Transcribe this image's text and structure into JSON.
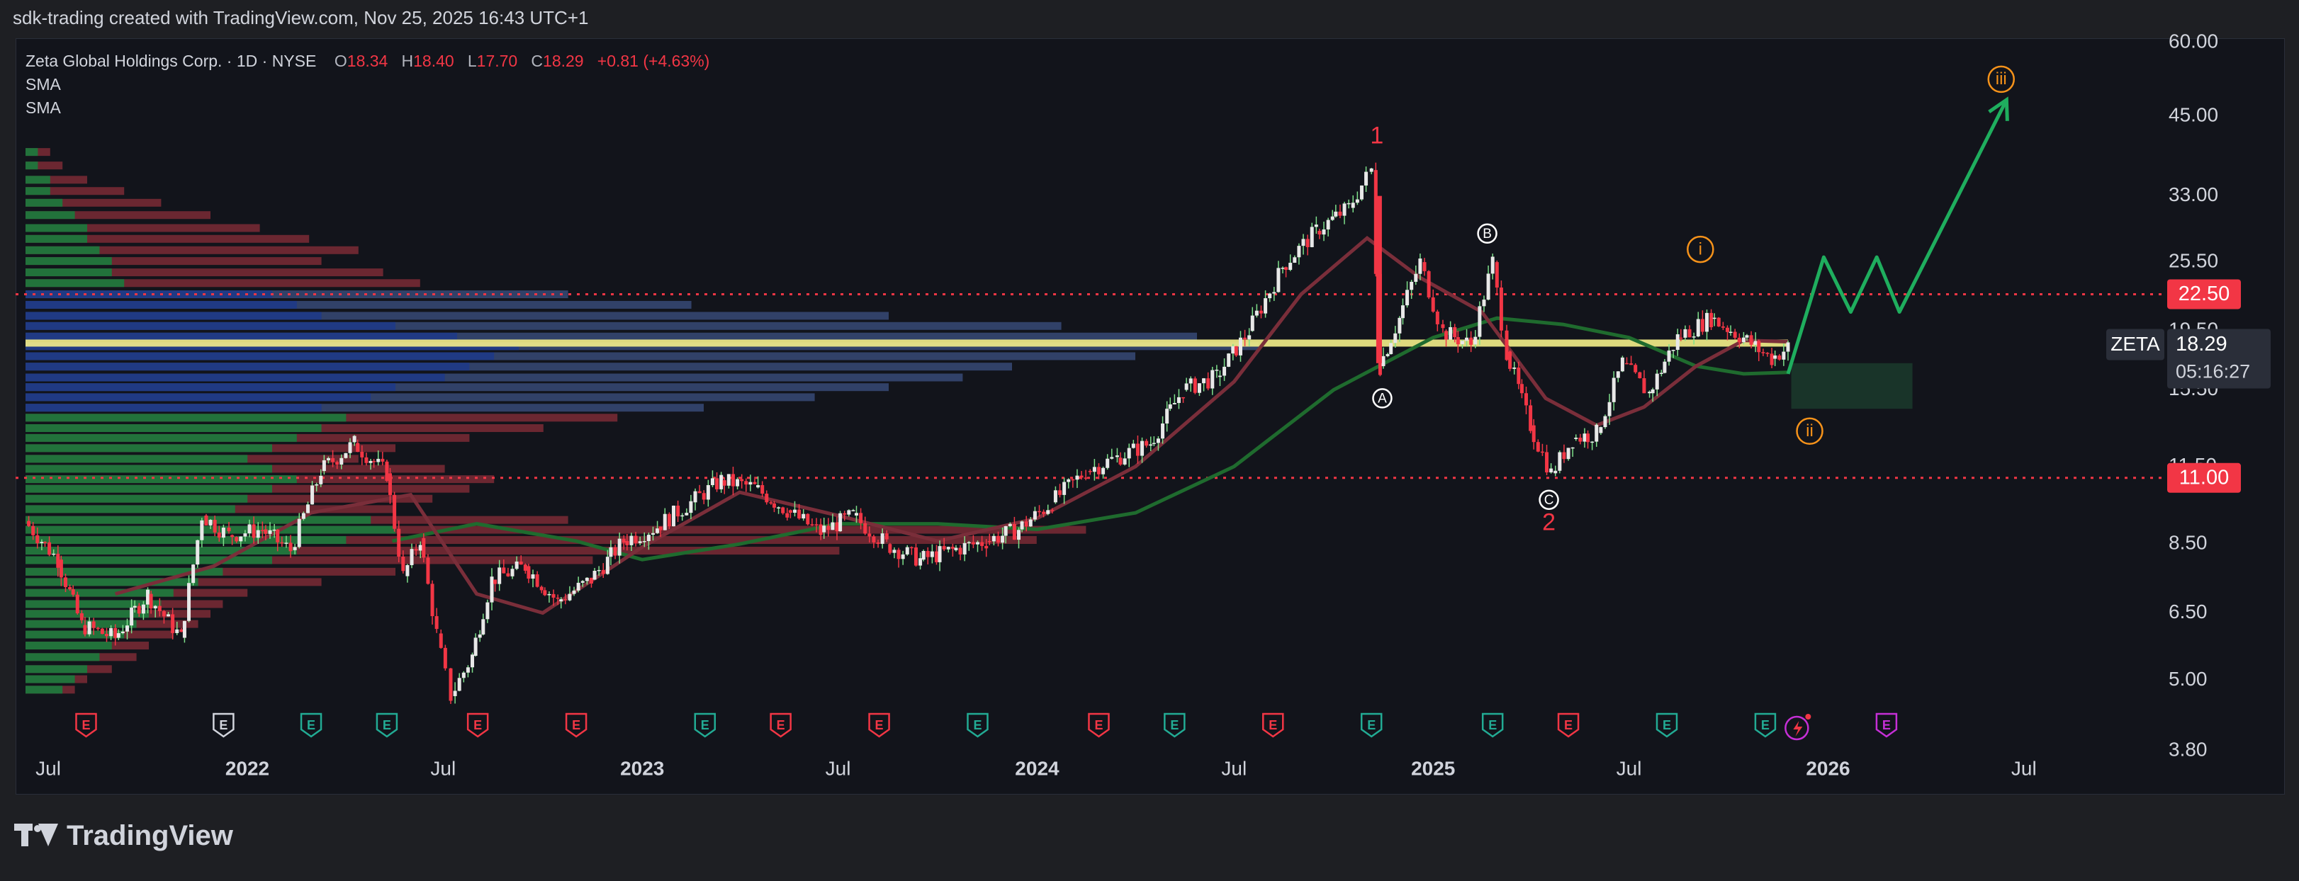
{
  "header": {
    "credit": "sdk-trading created with TradingView.com, Nov 25, 2025 16:43 UTC+1"
  },
  "legend": {
    "title": "Zeta Global Holdings Corp. · 1D · NYSE",
    "o_label": "O",
    "o": "18.34",
    "h_label": "H",
    "h": "18.40",
    "l_label": "L",
    "l": "17.70",
    "c_label": "C",
    "c": "18.29",
    "change": "+0.81 (+4.63%)",
    "indicators": [
      "SMA",
      "SMA"
    ]
  },
  "footer": {
    "brand": "TradingView"
  },
  "colors": {
    "up": "#22ab94",
    "down": "#f23645",
    "accent_orange": "#f7931a",
    "projection": "#1fae5e",
    "poc": "#f5ef8a",
    "sma_fast": "#7a2e3a",
    "sma_slow": "#1f6b2e"
  },
  "chart_data": {
    "type": "line",
    "symbol": "ZETA",
    "price_scale": "log",
    "ylim": [
      3.8,
      60
    ],
    "y_ticks": [
      "60.00",
      "45.00",
      "33.00",
      "25.50",
      "19.50",
      "15.50",
      "11.50",
      "8.50",
      "6.50",
      "5.00",
      "3.80"
    ],
    "x_ticks": [
      {
        "label": "Jul",
        "date": "2021-07-01"
      },
      {
        "label": "2022",
        "date": "2022-01-01",
        "bold": true
      },
      {
        "label": "Jul",
        "date": "2022-07-01"
      },
      {
        "label": "2023",
        "date": "2023-01-01",
        "bold": true
      },
      {
        "label": "Jul",
        "date": "2023-07-01"
      },
      {
        "label": "2024",
        "date": "2024-01-01",
        "bold": true
      },
      {
        "label": "Jul",
        "date": "2024-07-01"
      },
      {
        "label": "2025",
        "date": "2025-01-01",
        "bold": true
      },
      {
        "label": "Jul",
        "date": "2025-07-01"
      },
      {
        "label": "2026",
        "date": "2026-01-01",
        "bold": true
      },
      {
        "label": "Jul",
        "date": "2026-07-01"
      }
    ],
    "xlim": [
      "2021-06-10",
      "2026-10-10"
    ],
    "last_price": {
      "label": "ZETA",
      "value": "18.29",
      "countdown": "05:16:27"
    },
    "horizontal_levels": [
      {
        "price": 22.5,
        "label": "22.50"
      },
      {
        "price": 11.0,
        "label": "11.00"
      }
    ],
    "poc_price": 18.6,
    "price_path": [
      [
        "2021-06-10",
        9.3
      ],
      [
        "2021-07-10",
        8.0
      ],
      [
        "2021-08-01",
        6.2
      ],
      [
        "2021-09-01",
        5.9
      ],
      [
        "2021-10-01",
        7.0
      ],
      [
        "2021-11-01",
        5.9
      ],
      [
        "2021-11-20",
        9.5
      ],
      [
        "2021-12-15",
        8.8
      ],
      [
        "2022-01-15",
        9.0
      ],
      [
        "2022-02-10",
        8.3
      ],
      [
        "2022-03-10",
        11.3
      ],
      [
        "2022-04-10",
        12.6
      ],
      [
        "2022-05-10",
        11.2
      ],
      [
        "2022-05-25",
        7.5
      ],
      [
        "2022-06-10",
        8.7
      ],
      [
        "2022-06-25",
        6.0
      ],
      [
        "2022-07-08",
        4.7
      ],
      [
        "2022-07-28",
        5.5
      ],
      [
        "2022-08-15",
        7.4
      ],
      [
        "2022-09-15",
        7.8
      ],
      [
        "2022-10-15",
        6.8
      ],
      [
        "2022-11-15",
        7.4
      ],
      [
        "2022-12-15",
        8.6
      ],
      [
        "2023-01-15",
        9.1
      ],
      [
        "2023-02-15",
        10.0
      ],
      [
        "2023-03-15",
        10.9
      ],
      [
        "2023-04-15",
        10.6
      ],
      [
        "2023-05-15",
        9.7
      ],
      [
        "2023-06-15",
        8.9
      ],
      [
        "2023-07-15",
        9.5
      ],
      [
        "2023-08-15",
        8.5
      ],
      [
        "2023-09-15",
        8.0
      ],
      [
        "2023-10-15",
        8.3
      ],
      [
        "2023-11-15",
        8.6
      ],
      [
        "2023-12-15",
        9.0
      ],
      [
        "2024-01-15",
        10.0
      ],
      [
        "2024-02-15",
        11.3
      ],
      [
        "2024-03-15",
        11.9
      ],
      [
        "2024-04-15",
        12.6
      ],
      [
        "2024-05-15",
        15.5
      ],
      [
        "2024-06-15",
        16.3
      ],
      [
        "2024-07-15",
        19.5
      ],
      [
        "2024-08-15",
        25.0
      ],
      [
        "2024-09-15",
        28.8
      ],
      [
        "2024-10-15",
        31.5
      ],
      [
        "2024-11-05",
        36.5
      ],
      [
        "2024-11-13",
        17.0
      ],
      [
        "2024-12-01",
        20.5
      ],
      [
        "2024-12-20",
        25.5
      ],
      [
        "2025-01-10",
        19.5
      ],
      [
        "2025-02-05",
        18.5
      ],
      [
        "2025-02-25",
        25.5
      ],
      [
        "2025-03-10",
        18.0
      ],
      [
        "2025-04-01",
        13.5
      ],
      [
        "2025-04-20",
        11.2
      ],
      [
        "2025-05-10",
        12.8
      ],
      [
        "2025-06-01",
        13.1
      ],
      [
        "2025-06-25",
        17.2
      ],
      [
        "2025-07-20",
        15.3
      ],
      [
        "2025-08-15",
        19.0
      ],
      [
        "2025-09-15",
        20.5
      ],
      [
        "2025-10-15",
        19.0
      ],
      [
        "2025-11-10",
        17.5
      ],
      [
        "2025-11-25",
        18.29
      ]
    ],
    "sma_fast": [
      [
        "2021-09-01",
        7.0
      ],
      [
        "2021-12-01",
        7.8
      ],
      [
        "2022-03-01",
        9.6
      ],
      [
        "2022-06-01",
        10.3
      ],
      [
        "2022-08-01",
        7.0
      ],
      [
        "2022-10-01",
        6.5
      ],
      [
        "2023-01-01",
        8.4
      ],
      [
        "2023-04-01",
        10.4
      ],
      [
        "2023-07-01",
        9.5
      ],
      [
        "2023-10-01",
        8.6
      ],
      [
        "2024-01-01",
        9.4
      ],
      [
        "2024-04-01",
        11.5
      ],
      [
        "2024-07-01",
        16.0
      ],
      [
        "2024-09-01",
        22.5
      ],
      [
        "2024-11-01",
        28.0
      ],
      [
        "2024-12-20",
        24.0
      ],
      [
        "2025-02-15",
        21.0
      ],
      [
        "2025-04-15",
        15.0
      ],
      [
        "2025-06-01",
        13.5
      ],
      [
        "2025-07-15",
        14.5
      ],
      [
        "2025-09-01",
        17.0
      ],
      [
        "2025-10-15",
        18.8
      ],
      [
        "2025-11-25",
        18.7
      ]
    ],
    "sma_slow": [
      [
        "2022-05-15",
        8.6
      ],
      [
        "2022-08-01",
        9.2
      ],
      [
        "2022-11-01",
        8.6
      ],
      [
        "2023-01-01",
        8.0
      ],
      [
        "2023-04-01",
        8.5
      ],
      [
        "2023-07-01",
        9.2
      ],
      [
        "2023-10-01",
        9.2
      ],
      [
        "2024-01-01",
        9.0
      ],
      [
        "2024-04-01",
        9.6
      ],
      [
        "2024-07-01",
        11.5
      ],
      [
        "2024-10-01",
        15.5
      ],
      [
        "2025-01-01",
        19.0
      ],
      [
        "2025-03-01",
        20.5
      ],
      [
        "2025-05-01",
        20.0
      ],
      [
        "2025-07-01",
        19.0
      ],
      [
        "2025-09-01",
        17.0
      ],
      [
        "2025-10-15",
        16.5
      ],
      [
        "2025-11-25",
        16.6
      ]
    ],
    "projection": [
      [
        "2025-11-25",
        16.5
      ],
      [
        "2025-12-28",
        26.0
      ],
      [
        "2026-01-22",
        21.0
      ],
      [
        "2026-02-15",
        26.0
      ],
      [
        "2026-03-08",
        21.0
      ],
      [
        "2026-06-15",
        48.0
      ]
    ],
    "target_zone": {
      "x0": "2025-11-28",
      "x1": "2026-03-20",
      "y0": 17.2,
      "y1": 14.4
    },
    "wave_labels": [
      {
        "text": "1",
        "date": "2024-11-10",
        "price": 41.5,
        "style": "red"
      },
      {
        "text": "A",
        "date": "2024-11-15",
        "price": 15.0,
        "style": "circle-white"
      },
      {
        "text": "B",
        "date": "2025-02-20",
        "price": 28.5,
        "style": "circle-white"
      },
      {
        "text": "C",
        "date": "2025-04-18",
        "price": 10.1,
        "style": "circle-white"
      },
      {
        "text": "2",
        "date": "2025-04-18",
        "price": 9.2,
        "style": "red"
      },
      {
        "text": "i",
        "date": "2025-09-05",
        "price": 26.8,
        "style": "circle-orange"
      },
      {
        "text": "ii",
        "date": "2025-12-15",
        "price": 13.2,
        "style": "circle-orange"
      },
      {
        "text": "iii",
        "date": "2026-06-10",
        "price": 52.0,
        "style": "circle-orange"
      }
    ],
    "earnings": [
      {
        "date": "2021-08-05",
        "kind": "down",
        "label": "E"
      },
      {
        "date": "2021-12-10",
        "kind": "neutral",
        "label": "E"
      },
      {
        "date": "2022-03-01",
        "kind": "up",
        "label": "E"
      },
      {
        "date": "2022-05-10",
        "kind": "up",
        "label": "E"
      },
      {
        "date": "2022-08-02",
        "kind": "down",
        "label": "E"
      },
      {
        "date": "2022-11-01",
        "kind": "down",
        "label": "E"
      },
      {
        "date": "2023-02-28",
        "kind": "up",
        "label": "E"
      },
      {
        "date": "2023-05-09",
        "kind": "down",
        "label": "E"
      },
      {
        "date": "2023-08-08",
        "kind": "down",
        "label": "E"
      },
      {
        "date": "2023-11-07",
        "kind": "up",
        "label": "E"
      },
      {
        "date": "2024-02-27",
        "kind": "down",
        "label": "E"
      },
      {
        "date": "2024-05-07",
        "kind": "up",
        "label": "E"
      },
      {
        "date": "2024-08-06",
        "kind": "down",
        "label": "E"
      },
      {
        "date": "2024-11-05",
        "kind": "up",
        "label": "E"
      },
      {
        "date": "2025-02-25",
        "kind": "up",
        "label": "E"
      },
      {
        "date": "2025-05-06",
        "kind": "down",
        "label": "E"
      },
      {
        "date": "2025-08-05",
        "kind": "up",
        "label": "E"
      },
      {
        "date": "2025-11-04",
        "kind": "up",
        "label": "E"
      },
      {
        "date": "2026-02-24",
        "kind": "future",
        "label": "E"
      }
    ],
    "volume_profile": {
      "note": "bars grow rightward from left edge; value = relative length 0-1",
      "rows": [
        {
          "price": 39.0,
          "up": 0.01,
          "down": 0.02
        },
        {
          "price": 37.0,
          "up": 0.01,
          "down": 0.03
        },
        {
          "price": 35.0,
          "up": 0.02,
          "down": 0.05
        },
        {
          "price": 33.5,
          "up": 0.02,
          "down": 0.08
        },
        {
          "price": 32.0,
          "up": 0.03,
          "down": 0.11
        },
        {
          "price": 30.5,
          "up": 0.04,
          "down": 0.15
        },
        {
          "price": 29.0,
          "up": 0.05,
          "down": 0.19
        },
        {
          "price": 27.8,
          "up": 0.05,
          "down": 0.23
        },
        {
          "price": 26.6,
          "up": 0.06,
          "down": 0.27
        },
        {
          "price": 25.5,
          "up": 0.07,
          "down": 0.24
        },
        {
          "price": 24.4,
          "up": 0.07,
          "down": 0.29
        },
        {
          "price": 23.4,
          "up": 0.08,
          "down": 0.32
        },
        {
          "price": 22.4,
          "up": 0.2,
          "down": 0.44,
          "va": true
        },
        {
          "price": 21.5,
          "up": 0.22,
          "down": 0.54,
          "va": true
        },
        {
          "price": 20.6,
          "up": 0.24,
          "down": 0.7,
          "va": true
        },
        {
          "price": 19.8,
          "up": 0.3,
          "down": 0.84,
          "va": true
        },
        {
          "price": 19.0,
          "up": 0.35,
          "down": 0.95,
          "va": true
        },
        {
          "price": 18.3,
          "up": 0.4,
          "down": 1.0,
          "va": true
        },
        {
          "price": 17.6,
          "up": 0.38,
          "down": 0.9,
          "va": true
        },
        {
          "price": 16.9,
          "up": 0.36,
          "down": 0.8,
          "va": true
        },
        {
          "price": 16.2,
          "up": 0.34,
          "down": 0.76,
          "va": true
        },
        {
          "price": 15.6,
          "up": 0.3,
          "down": 0.7,
          "va": true
        },
        {
          "price": 15.0,
          "up": 0.28,
          "down": 0.64,
          "va": true
        },
        {
          "price": 14.4,
          "up": 0.24,
          "down": 0.55,
          "va": true
        },
        {
          "price": 13.85,
          "up": 0.26,
          "down": 0.48
        },
        {
          "price": 13.3,
          "up": 0.24,
          "down": 0.42
        },
        {
          "price": 12.8,
          "up": 0.22,
          "down": 0.36
        },
        {
          "price": 12.3,
          "up": 0.2,
          "down": 0.3
        },
        {
          "price": 11.8,
          "up": 0.18,
          "down": 0.27
        },
        {
          "price": 11.35,
          "up": 0.2,
          "down": 0.34
        },
        {
          "price": 10.9,
          "up": 0.22,
          "down": 0.38
        },
        {
          "price": 10.5,
          "up": 0.2,
          "down": 0.36
        },
        {
          "price": 10.1,
          "up": 0.18,
          "down": 0.33
        },
        {
          "price": 9.7,
          "up": 0.17,
          "down": 0.3
        },
        {
          "price": 9.3,
          "up": 0.28,
          "down": 0.44
        },
        {
          "price": 8.95,
          "up": 0.3,
          "down": 0.86
        },
        {
          "price": 8.6,
          "up": 0.26,
          "down": 0.82
        },
        {
          "price": 8.25,
          "up": 0.22,
          "down": 0.66
        },
        {
          "price": 7.95,
          "up": 0.2,
          "down": 0.46
        },
        {
          "price": 7.6,
          "up": 0.16,
          "down": 0.3
        },
        {
          "price": 7.3,
          "up": 0.14,
          "down": 0.24
        },
        {
          "price": 7.0,
          "up": 0.12,
          "down": 0.18
        },
        {
          "price": 6.7,
          "up": 0.11,
          "down": 0.16
        },
        {
          "price": 6.45,
          "up": 0.1,
          "down": 0.15
        },
        {
          "price": 6.2,
          "up": 0.09,
          "down": 0.14
        },
        {
          "price": 5.95,
          "up": 0.08,
          "down": 0.12
        },
        {
          "price": 5.7,
          "up": 0.07,
          "down": 0.1
        },
        {
          "price": 5.45,
          "up": 0.06,
          "down": 0.09
        },
        {
          "price": 5.2,
          "up": 0.05,
          "down": 0.07
        },
        {
          "price": 5.0,
          "up": 0.04,
          "down": 0.05
        },
        {
          "price": 4.8,
          "up": 0.03,
          "down": 0.04
        }
      ]
    }
  }
}
